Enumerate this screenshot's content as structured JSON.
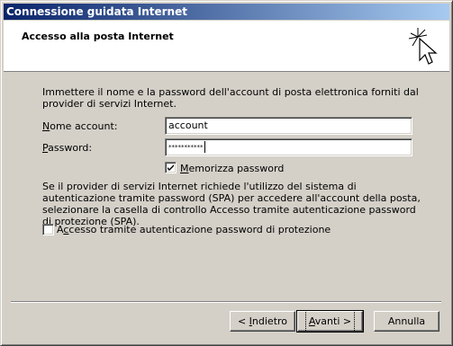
{
  "window": {
    "title": "Connessione guidata Internet"
  },
  "header": {
    "title": "Accesso alla posta Internet",
    "icon": "wizard-wand-cursor-icon"
  },
  "body": {
    "intro": "Immettere il nome e la password dell'account di posta elettronica forniti dal provider di servizi Internet.",
    "account_label": "Nome account:",
    "account_value": "account",
    "password_label": "Password:",
    "password_value": "***********",
    "remember_label": "Memorizza password",
    "remember_checked": true,
    "spa_text": "Se il provider di servizi Internet richiede l'utilizzo del sistema di autenticazione tramite password (SPA) per accedere all'account della posta, selezionare la casella di controllo Accesso tramite autenticazione password di protezione (SPA).",
    "spa_label": "Accesso tramite autenticazione password di protezione",
    "spa_checked": false
  },
  "buttons": {
    "back": "< Indietro",
    "next": "Avanti >",
    "cancel": "Annulla"
  }
}
